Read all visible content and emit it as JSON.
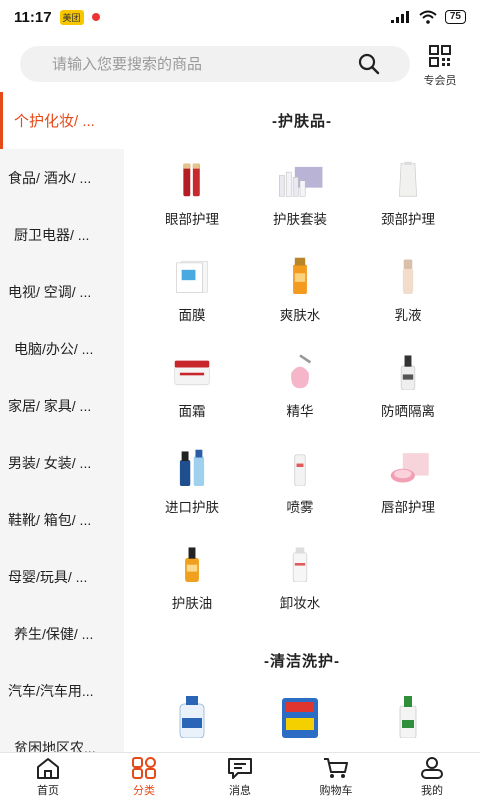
{
  "status_bar": {
    "time": "11:17",
    "app_badge": "美团",
    "battery": "75"
  },
  "search": {
    "placeholder": "请输入您要搜索的商品"
  },
  "member": {
    "label": "专会员"
  },
  "sidebar": {
    "items": [
      {
        "label": "个护化妆/ ..."
      },
      {
        "label": "食品/ 酒水/ ..."
      },
      {
        "label": "厨卫电器/ ..."
      },
      {
        "label": "电视/ 空调/ ..."
      },
      {
        "label": "电脑/办公/ ..."
      },
      {
        "label": "家居/ 家具/ ..."
      },
      {
        "label": "男装/ 女装/ ..."
      },
      {
        "label": "鞋靴/ 箱包/ ..."
      },
      {
        "label": "母婴/玩具/ ..."
      },
      {
        "label": "养生/保健/ ..."
      },
      {
        "label": "汽车/汽车用..."
      },
      {
        "label": "贫困地区农..."
      }
    ]
  },
  "sections": [
    {
      "title": "-护肤品-",
      "items": [
        {
          "label": "眼部护理",
          "icon": "eye-care-product-icon"
        },
        {
          "label": "护肤套装",
          "icon": "skincare-set-product-icon"
        },
        {
          "label": "颈部护理",
          "icon": "neck-care-product-icon"
        },
        {
          "label": "面膜",
          "icon": "face-mask-product-icon"
        },
        {
          "label": "爽肤水",
          "icon": "toner-product-icon"
        },
        {
          "label": "乳液",
          "icon": "lotion-product-icon"
        },
        {
          "label": "面霜",
          "icon": "face-cream-product-icon"
        },
        {
          "label": "精华",
          "icon": "serum-product-icon"
        },
        {
          "label": "防晒隔离",
          "icon": "sunscreen-product-icon"
        },
        {
          "label": "进口护肤",
          "icon": "imported-skincare-product-icon"
        },
        {
          "label": "喷雾",
          "icon": "spray-product-icon"
        },
        {
          "label": "唇部护理",
          "icon": "lip-care-product-icon"
        },
        {
          "label": "护肤油",
          "icon": "skin-oil-product-icon"
        },
        {
          "label": "卸妆水",
          "icon": "makeup-remover-product-icon"
        }
      ]
    },
    {
      "title": "-清洁洗护-",
      "items": [
        {
          "icon": "laundry-detergent-product-icon"
        },
        {
          "icon": "detergent-powder-product-icon"
        },
        {
          "icon": "cleaner-bottle-product-icon"
        }
      ]
    }
  ],
  "tabs": [
    {
      "label": "首页",
      "icon": "home-icon"
    },
    {
      "label": "分类",
      "icon": "category-icon"
    },
    {
      "label": "消息",
      "icon": "message-icon"
    },
    {
      "label": "购物车",
      "icon": "cart-icon"
    },
    {
      "label": "我的",
      "icon": "profile-icon"
    }
  ],
  "colors": {
    "accent": "#e64a19",
    "sidebar_bg": "#f5f5f5"
  }
}
